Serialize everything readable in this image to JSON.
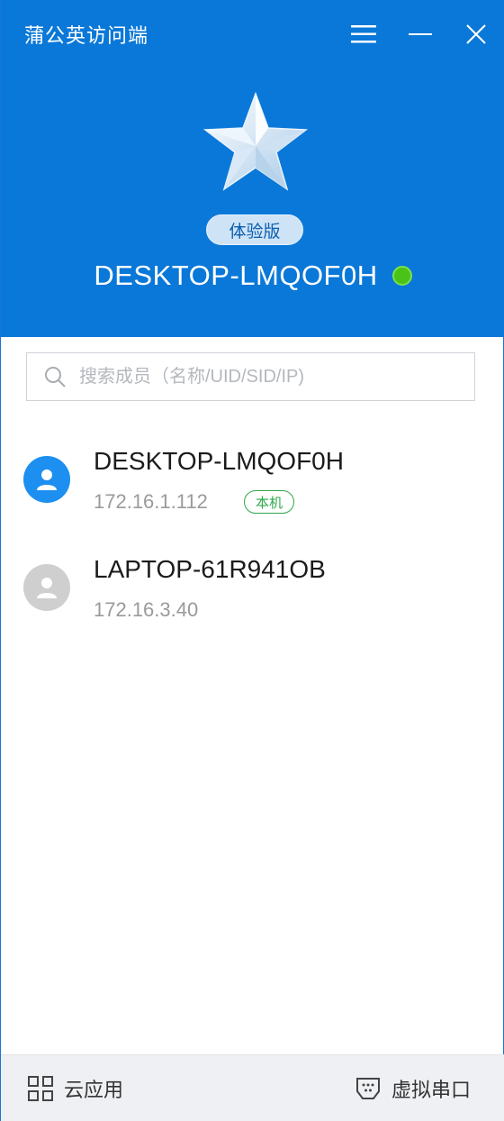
{
  "app": {
    "title": "蒲公英访问端"
  },
  "header": {
    "edition_badge": "体验版",
    "device_name": "DESKTOP-LMQOF0H",
    "status_color": "#49c317"
  },
  "search": {
    "placeholder": "搜索成员（名称/UID/SID/IP)"
  },
  "members": [
    {
      "name": "DESKTOP-LMQOF0H",
      "ip": "172.16.1.112",
      "tag": "本机",
      "avatar_color": "#1c8ff0"
    },
    {
      "name": "LAPTOP-61R941OB",
      "ip": "172.16.3.40",
      "avatar_color": "#cfcfcf"
    }
  ],
  "footer": {
    "cloud_apps_label": "云应用",
    "virtual_serial_label": "虚拟串口"
  },
  "colors": {
    "header_bg": "#0a78d8",
    "accent": "#1c8ff0",
    "tag_green": "#2fa84a"
  }
}
